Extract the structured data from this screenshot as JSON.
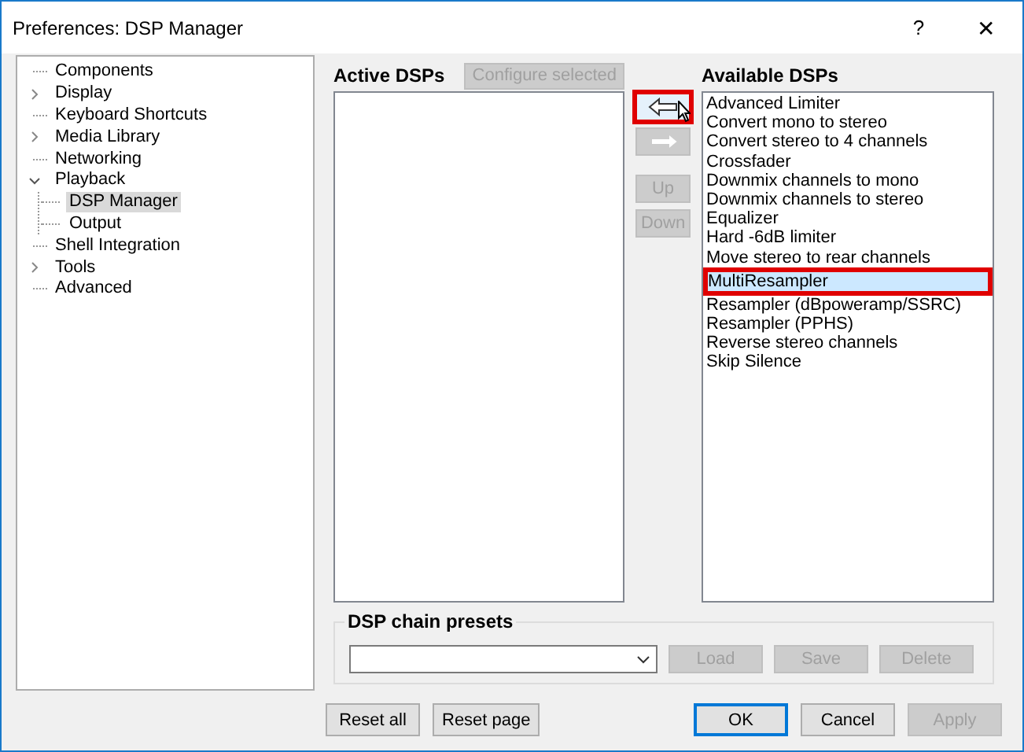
{
  "window": {
    "title": "Preferences: DSP Manager",
    "help": "?",
    "close": "✕"
  },
  "tree": [
    {
      "label": "Components",
      "selected": false
    },
    {
      "label": "Display",
      "selected": false,
      "expanded": false
    },
    {
      "label": "Keyboard Shortcuts",
      "selected": false
    },
    {
      "label": "Media Library",
      "selected": false,
      "expanded": false
    },
    {
      "label": "Networking",
      "selected": false
    },
    {
      "label": "Playback",
      "selected": false,
      "expanded": true,
      "children": [
        {
          "label": "DSP Manager",
          "selected": true
        },
        {
          "label": "Output",
          "selected": false
        }
      ]
    },
    {
      "label": "Shell Integration",
      "selected": false
    },
    {
      "label": "Tools",
      "selected": false,
      "expanded": false
    },
    {
      "label": "Advanced",
      "selected": false
    }
  ],
  "active_dsps": {
    "title": "Active DSPs",
    "configure_button": {
      "label": "Configure selected",
      "disabled": true
    }
  },
  "move_buttons": [
    {
      "kind": "left",
      "disabled": false,
      "annotated": true
    },
    {
      "kind": "right",
      "disabled": true,
      "annotated": false
    },
    {
      "kind": "text",
      "label": "Up",
      "disabled": true,
      "annotated": false
    },
    {
      "kind": "text",
      "label": "Down",
      "disabled": true,
      "annotated": false
    }
  ],
  "available_dsps": {
    "title": "Available DSPs",
    "items": [
      {
        "label": "Advanced Limiter",
        "selected": false,
        "annotated": false
      },
      {
        "label": "Convert mono to stereo",
        "selected": false,
        "annotated": false
      },
      {
        "label": "Convert stereo to 4 channels",
        "selected": false,
        "annotated": false
      },
      {
        "label": "Crossfader",
        "selected": false,
        "annotated": false
      },
      {
        "label": "Downmix channels to mono",
        "selected": false,
        "annotated": false
      },
      {
        "label": "Downmix channels to stereo",
        "selected": false,
        "annotated": false
      },
      {
        "label": "Equalizer",
        "selected": false,
        "annotated": false
      },
      {
        "label": "Hard -6dB limiter",
        "selected": false,
        "annotated": false
      },
      {
        "label": "Move stereo to rear channels",
        "selected": false,
        "annotated": false
      },
      {
        "label": "MultiResampler",
        "selected": true,
        "annotated": true
      },
      {
        "label": "Resampler (dBpoweramp/SSRC)",
        "selected": false,
        "annotated": false
      },
      {
        "label": "Resampler (PPHS)",
        "selected": false,
        "annotated": false
      },
      {
        "label": "Reverse stereo channels",
        "selected": false,
        "annotated": false
      },
      {
        "label": "Skip Silence",
        "selected": false,
        "annotated": false
      }
    ]
  },
  "presets": {
    "title": "DSP chain presets",
    "buttons": [
      {
        "label": "Load",
        "disabled": true
      },
      {
        "label": "Save",
        "disabled": true
      },
      {
        "label": "Delete",
        "disabled": true
      }
    ]
  },
  "footer": {
    "left_buttons": [
      {
        "label": "Reset all",
        "disabled": false,
        "default": false
      },
      {
        "label": "Reset page",
        "disabled": false,
        "default": false
      }
    ],
    "right_buttons": [
      {
        "label": "OK",
        "disabled": false,
        "default": true
      },
      {
        "label": "Cancel",
        "disabled": false,
        "default": false
      },
      {
        "label": "Apply",
        "disabled": true,
        "default": false
      }
    ]
  }
}
